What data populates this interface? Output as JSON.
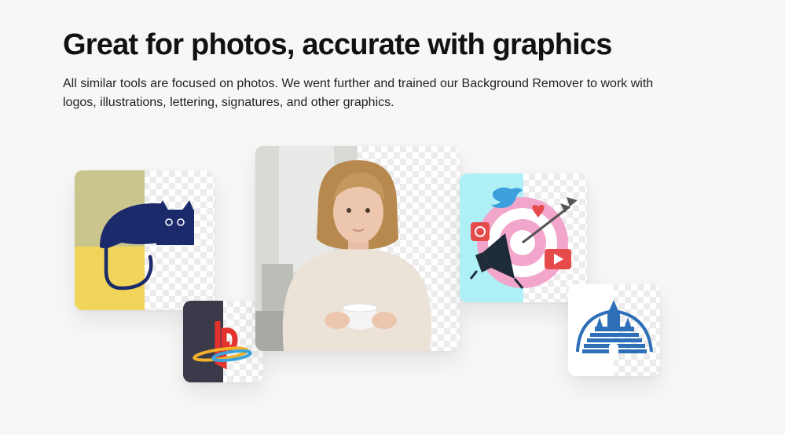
{
  "hero": {
    "title": "Great for photos, accurate with graphics",
    "description": "All similar tools are focused on photos. We went further and trained our Background Remover to work with logos, illustrations, lettering, signatures, and other graphics."
  },
  "colors": {
    "background": "#f7f7f8",
    "heading": "#111111",
    "cat_navy": "#1a2a6b",
    "castle_blue": "#2d6fb8",
    "marketing_cyan": "#aef0f6",
    "marketing_pink": "#f3a6cb",
    "playstation_dark": "#3b3a4a"
  },
  "showcase": {
    "cards": [
      {
        "name": "cat-illustration",
        "icon": "cat-illustration-icon"
      },
      {
        "name": "playstation-logo",
        "icon": "playstation-logo-icon"
      },
      {
        "name": "woman-photo",
        "icon": "woman-with-cup-photo"
      },
      {
        "name": "marketing-illustration",
        "icon": "megaphone-target-icon"
      },
      {
        "name": "castle-logo",
        "icon": "castle-logo-icon"
      }
    ]
  }
}
